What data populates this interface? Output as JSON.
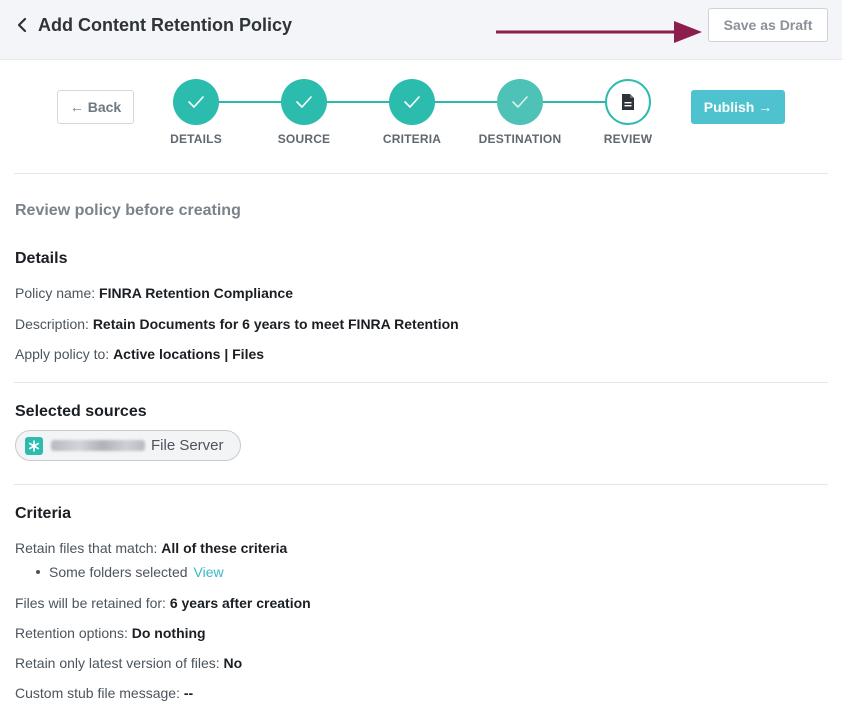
{
  "header": {
    "title": "Add Content Retention Policy",
    "save_draft_label": "Save as Draft"
  },
  "wizard": {
    "back_label": "← Back",
    "publish_label": "Publish →",
    "steps": [
      {
        "label": "DETAILS",
        "status": "complete"
      },
      {
        "label": "SOURCE",
        "status": "complete"
      },
      {
        "label": "CRITERIA",
        "status": "complete"
      },
      {
        "label": "DESTINATION",
        "status": "complete"
      },
      {
        "label": "REVIEW",
        "status": "current"
      }
    ]
  },
  "review": {
    "subtitle": "Review policy before creating",
    "details": {
      "title": "Details",
      "policy_name_label": "Policy name:",
      "policy_name_value": "FINRA Retention Compliance",
      "description_label": "Description:",
      "description_value": "Retain Documents for 6 years to meet FINRA Retention",
      "apply_label": "Apply policy to:",
      "apply_value": "Active locations | Files"
    },
    "sources": {
      "title": "Selected sources",
      "items": [
        {
          "icon": "asterisk-icon",
          "name": "File Server"
        }
      ]
    },
    "criteria": {
      "title": "Criteria",
      "match_label": "Retain files that match:",
      "match_value": "All of these criteria",
      "bullet_text": "Some folders selected",
      "bullet_link": "View",
      "retained_label": "Files will be retained for:",
      "retained_value": "6 years after creation",
      "options_label": "Retention options:",
      "options_value": "Do nothing",
      "latest_label": "Retain only latest version of files:",
      "latest_value": "No",
      "stub_label": "Custom stub file message:",
      "stub_value": "--"
    }
  },
  "colors": {
    "accent_teal": "#2cbcae",
    "publish_blue": "#4ec3cf",
    "annotation_arrow": "#8c1d4e"
  }
}
